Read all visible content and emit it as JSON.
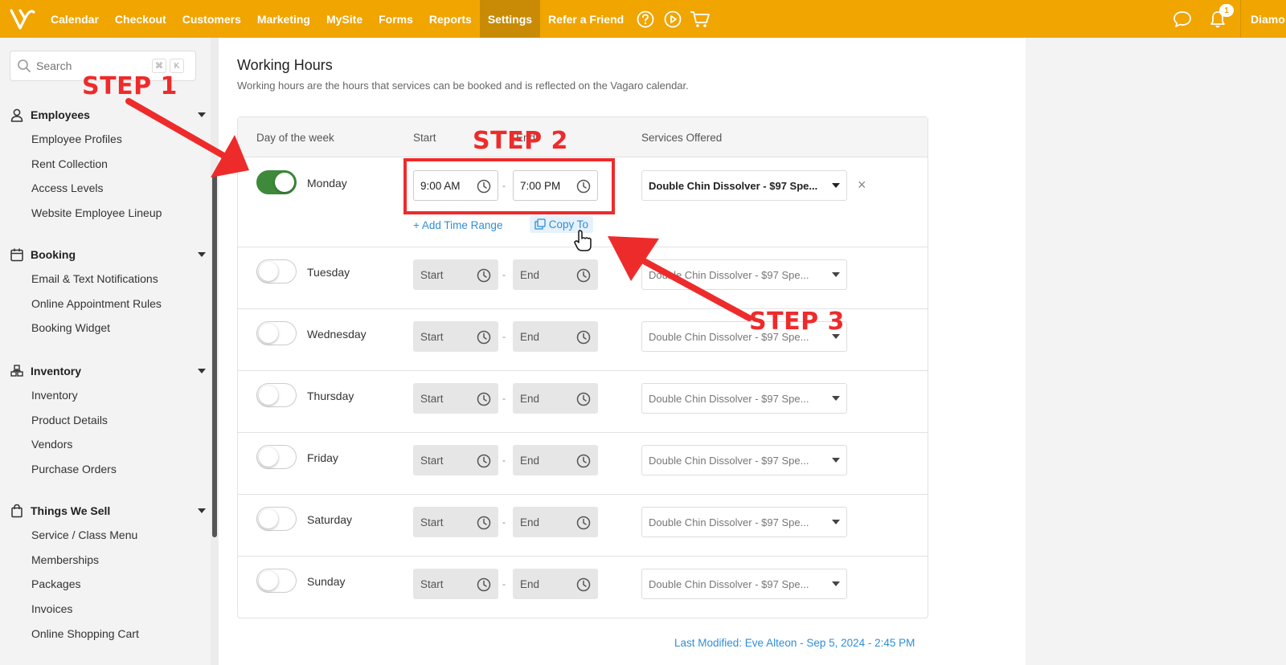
{
  "topnav": {
    "items": [
      "Calendar",
      "Checkout",
      "Customers",
      "Marketing",
      "MySite",
      "Forms",
      "Reports",
      "Settings",
      "Refer a Friend"
    ],
    "active": "Settings",
    "notification_count": "1",
    "user_name": "Diamo",
    "brand_color": "#f0a500"
  },
  "sidebar": {
    "search_placeholder": "Search",
    "search_shortcut": [
      "⌘",
      "K"
    ],
    "sections": [
      {
        "label": "Employees",
        "icon": "person-icon",
        "items": [
          "Employee Profiles",
          "Rent Collection",
          "Access Levels",
          "Website Employee Lineup"
        ]
      },
      {
        "label": "Booking",
        "icon": "calendar-icon",
        "items": [
          "Email & Text Notifications",
          "Online Appointment Rules",
          "Booking Widget"
        ]
      },
      {
        "label": "Inventory",
        "icon": "boxes-icon",
        "items": [
          "Inventory",
          "Product Details",
          "Vendors",
          "Purchase Orders"
        ]
      },
      {
        "label": "Things We Sell",
        "icon": "bag-icon",
        "items": [
          "Service / Class Menu",
          "Memberships",
          "Packages",
          "Invoices",
          "Online Shopping Cart"
        ]
      }
    ]
  },
  "main": {
    "title": "Working Hours",
    "subtitle": "Working hours are the hours that services can be booked and is reflected on the Vagaro calendar.",
    "columns": {
      "day": "Day of the week",
      "start": "Start",
      "end": "End",
      "services": "Services Offered"
    },
    "rows": [
      {
        "day": "Monday",
        "enabled": true,
        "start": "9:00 AM",
        "end": "7:00 PM",
        "service": "Double Chin Dissolver - $97 Spe..."
      },
      {
        "day": "Tuesday",
        "enabled": false,
        "start": "Start",
        "end": "End",
        "service": "Double Chin Dissolver - $97 Spe..."
      },
      {
        "day": "Wednesday",
        "enabled": false,
        "start": "Start",
        "end": "End",
        "service": "Double Chin Dissolver - $97 Spe..."
      },
      {
        "day": "Thursday",
        "enabled": false,
        "start": "Start",
        "end": "End",
        "service": "Double Chin Dissolver - $97 Spe..."
      },
      {
        "day": "Friday",
        "enabled": false,
        "start": "Start",
        "end": "End",
        "service": "Double Chin Dissolver - $97 Spe..."
      },
      {
        "day": "Saturday",
        "enabled": false,
        "start": "Start",
        "end": "End",
        "service": "Double Chin Dissolver - $97 Spe..."
      },
      {
        "day": "Sunday",
        "enabled": false,
        "start": "Start",
        "end": "End",
        "service": "Double Chin Dissolver - $97 Spe..."
      }
    ],
    "add_time_range": "+ Add Time Range",
    "copy_to": "Copy To",
    "last_modified": "Last Modified: Eve Alteon - Sep 5, 2024 - 2:45 PM"
  },
  "annotations": {
    "step1": "STEP 1",
    "step2": "STEP 2",
    "step3": "STEP 3",
    "color": "#ee2b2b"
  }
}
